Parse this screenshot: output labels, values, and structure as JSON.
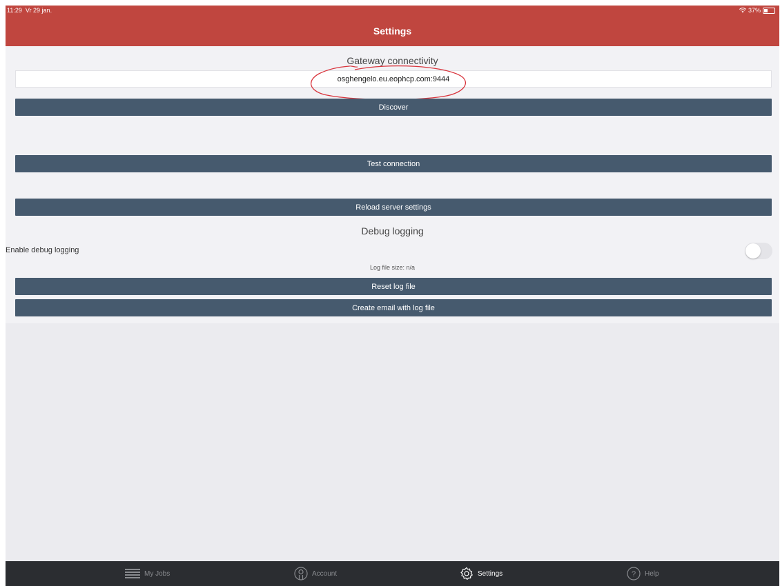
{
  "status_bar": {
    "time": "11:29",
    "date": "Vr 29 jan.",
    "battery": "37%"
  },
  "header": {
    "title": "Settings"
  },
  "gateway": {
    "section_title": "Gateway connectivity",
    "address_value": "osghengelo.eu.eophcp.com:9444",
    "discover_label": "Discover",
    "test_connection_label": "Test connection",
    "reload_label": "Reload server settings"
  },
  "debug": {
    "section_title": "Debug logging",
    "enable_label": "Enable debug logging",
    "enabled": false,
    "log_size_label": "Log file size:  n/a",
    "reset_label": "Reset log file",
    "email_label": "Create email with log file"
  },
  "tabbar": {
    "items": [
      {
        "label": "My Jobs",
        "icon": "list-icon",
        "active": false
      },
      {
        "label": "Account",
        "icon": "account-icon",
        "active": false
      },
      {
        "label": "Settings",
        "icon": "gear-icon",
        "active": true
      },
      {
        "label": "Help",
        "icon": "help-icon",
        "active": false
      }
    ]
  },
  "colors": {
    "header": "#c0463f",
    "button": "#465a6e",
    "tabbar": "#2b2d31",
    "annotation": "#d9363e"
  }
}
